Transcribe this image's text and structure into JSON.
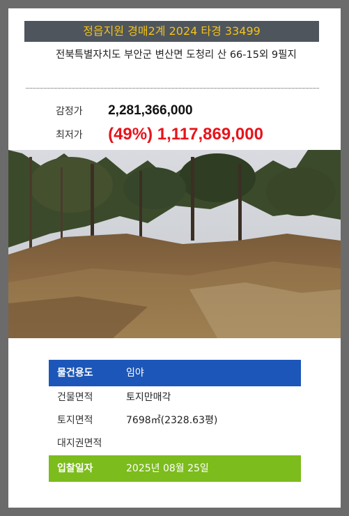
{
  "header": {
    "title": "정읍지원 경매2계 2024 타경 33499"
  },
  "property": {
    "address": "전북특별자치도 부안군 변산면 도청리 산 66-15외 9필지"
  },
  "prices": {
    "appraisal_label": "감정가",
    "appraisal_value": "2,281,366,000",
    "minimum_label": "최저가",
    "minimum_value": "(49%) 1,117,869,000"
  },
  "photo": {
    "subject": "forest-land-photo"
  },
  "info": {
    "usage_label": "물건용도",
    "usage_value": "임야",
    "building_area_label": "건물면적",
    "building_area_value": "토지만매각",
    "land_area_label": "토지면적",
    "land_area_value": "7698㎡(2328.63평)",
    "land_right_label": "대지권면적",
    "land_right_value": "",
    "bid_date_label": "입찰일자",
    "bid_date_value": "2025년 08월 25일"
  },
  "colors": {
    "header_bg": "#4f555c",
    "header_text": "#f2c21b",
    "minimum_price": "#e8131b",
    "usage_row": "#1c56b8",
    "bid_row": "#7cbc1c"
  }
}
